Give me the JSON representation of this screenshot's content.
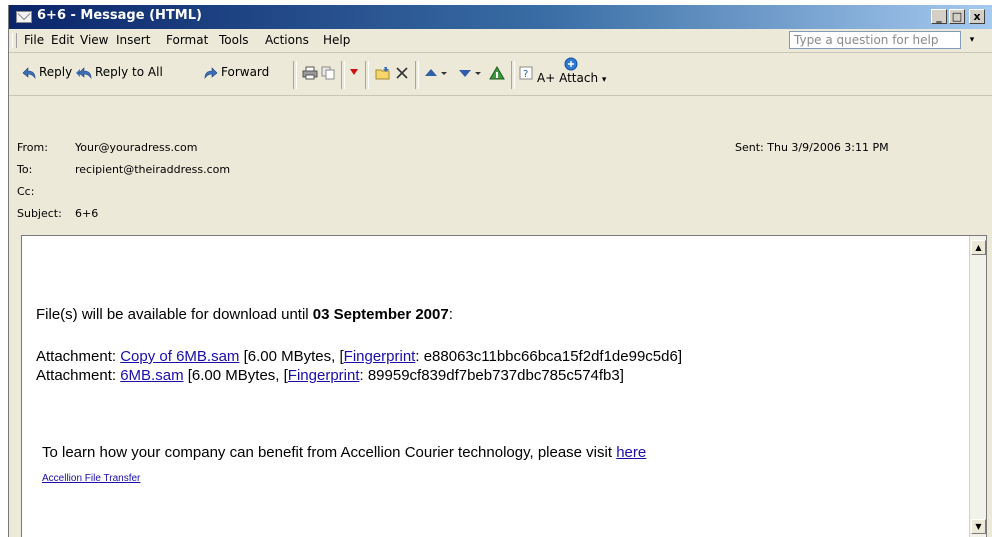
{
  "window": {
    "title": "6+6 - Message (HTML)",
    "minimize_label": "_",
    "maximize_label": "□",
    "close_label": "x"
  },
  "menu": {
    "items": [
      "File",
      "Edit",
      "View",
      "Insert",
      "Format",
      "Tools",
      "Actions",
      "Help"
    ],
    "help_placeholder": "Type a question for help",
    "help_dropdown": "▾"
  },
  "toolbar": {
    "reply": "Reply",
    "reply_all": "Reply to All",
    "forward": "Forward",
    "attach": "Attach",
    "attach_prefix": "A+"
  },
  "header": {
    "from_label": "From:",
    "from_value": "Your@youradress.com",
    "to_label": "To:",
    "to_value": "recipient@theiraddress.com",
    "cc_label": "Cc:",
    "subject_label": "Subject:",
    "subject_value": "6+6",
    "sent_label": "Sent:",
    "sent_value": "Thu 3/9/2006 3:11 PM"
  },
  "body": {
    "avail_prefix": "File(s) will be available for download until ",
    "avail_date": "03 September 2007",
    "avail_suffix": ":",
    "attachments": [
      {
        "label": "Attachment: ",
        "name": "Copy of 6MB.sam",
        "size": " [6.00 MBytes, ",
        "fp_open": "[",
        "fp_link": "Fingerprint",
        "fp_value": ": e88063c11bbc66bca15f2df1de99c5d6]"
      },
      {
        "label": "Attachment: ",
        "name": "6MB.sam",
        "size": " [6.00 MBytes,  ",
        "fp_open": "[",
        "fp_link": "Fingerprint",
        "fp_value": ": 89959cf839df7beb737dbc785c574fb3]"
      }
    ],
    "learn_text": "To learn how your company can benefit from Accellion Courier technology, please visit ",
    "learn_link": "here",
    "accellion_link": "Accellion File Transfer"
  },
  "colors": {
    "title_bar": "#0a246a",
    "link": "#1a0dab",
    "chrome": "#ece9d8"
  }
}
